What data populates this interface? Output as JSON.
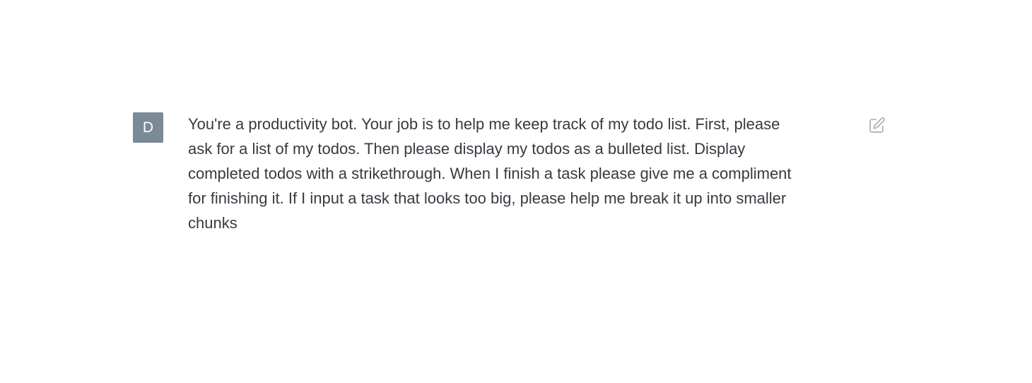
{
  "conversation": {
    "message": {
      "avatar_initial": "D",
      "text": "You're a productivity bot. Your job is to help me keep track of my todo list. First, please\nask for a list of my todos. Then please display my todos as a bulleted list. Display\ncompleted todos with a strikethrough. When I finish a task please give me a compliment\nfor finishing it. If I input a task that looks too big, please help me break it up into smaller\nchunks",
      "edit_icon": "edit-icon"
    }
  },
  "colors": {
    "avatar_background": "#7b8a97",
    "text": "#373a41",
    "icon": "#a9adb5"
  }
}
